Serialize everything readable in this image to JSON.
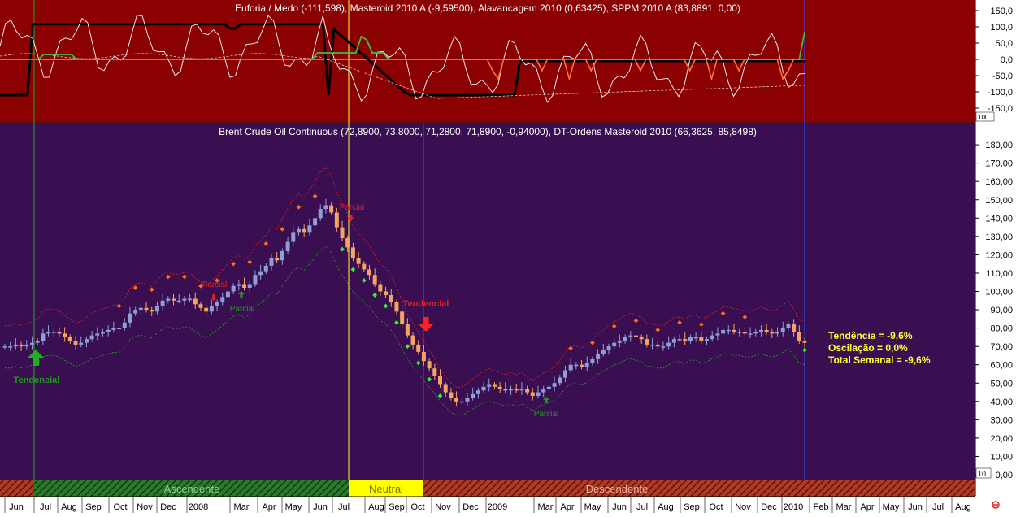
{
  "top_panel": {
    "title": "Euforia / Medo (-111,598), Masteroid 2010 A (-9,59500), Alavancagem 2010 (0,63425), SPPM 2010 A (83,8891, 0,00)",
    "y_ticks": [
      "150,0",
      "100,0",
      "50,0",
      "0,0",
      "-50,0",
      "-100,0",
      "-150,0"
    ],
    "scale_badge": "100",
    "background": "#8b0000"
  },
  "main_panel": {
    "title": "Brent Crude Oil Continuous (72,8900, 73,8000, 71,2800, 71,8900, -0,94000), DT-Ordens Masteroid 2010 (66,3625, 85,8498)",
    "y_ticks": [
      "180,00",
      "170,00",
      "160,00",
      "150,00",
      "140,00",
      "130,00",
      "120,00",
      "110,00",
      "100,00",
      "90,00",
      "80,00",
      "70,00",
      "60,00",
      "50,00",
      "40,00",
      "30,00",
      "20,00",
      "10,00",
      "0,00"
    ],
    "scale_badge": "10",
    "background": "#3a0f52",
    "annotations": [
      {
        "text": "Tendencial",
        "color": "#1f9a1f"
      },
      {
        "text": "Parcial",
        "color": "#e02020"
      },
      {
        "text": "Parcial",
        "color": "#1f9a1f"
      },
      {
        "text": "Parcial",
        "color": "#e02020"
      },
      {
        "text": "Tendencial",
        "color": "#e02020"
      },
      {
        "text": "Parcial",
        "color": "#1f9a1f"
      }
    ]
  },
  "status": {
    "tendencia": "Tendência = -9,6%",
    "oscilacao": "Oscilação = 0,0%",
    "total": "Total Semanal = -9,6%"
  },
  "regime_bar": {
    "ascendente": "Ascendente",
    "neutral": "Neutral",
    "descendente": "Descendente"
  },
  "x_axis": {
    "labels": [
      "Jun",
      "Jul",
      "Aug",
      "Sep",
      "Oct",
      "Nov",
      "Dec",
      "2008",
      "Mar",
      "Apr",
      "May",
      "Jun",
      "Jul",
      "Aug",
      "Sep",
      "Oct",
      "Nov",
      "Dec",
      "2009",
      "Mar",
      "Apr",
      "May",
      "Jun",
      "Jul",
      "Aug",
      "Sep",
      "Oct",
      "Nov",
      "Dec",
      "2010",
      "Feb",
      "Mar",
      "Apr",
      "May",
      "Jun",
      "Jul",
      "Aug"
    ]
  },
  "chart_data": {
    "type": "candlestick",
    "title": "Brent Crude Oil Continuous (72,8900, 73,8000, 71,2800, 71,8900, -0,94000)",
    "ylim": [
      0,
      190
    ],
    "close": [
      70,
      70,
      71,
      70,
      71,
      72,
      73,
      77,
      78,
      78,
      77,
      75,
      73,
      71,
      72,
      74,
      76,
      77,
      78,
      79,
      80,
      80,
      83,
      88,
      90,
      91,
      90,
      89,
      92,
      95,
      96,
      95,
      95,
      96,
      96,
      93,
      91,
      89,
      92,
      94,
      97,
      100,
      103,
      104,
      102,
      104,
      109,
      111,
      114,
      118,
      117,
      122,
      127,
      132,
      134,
      132,
      136,
      140,
      145,
      147,
      143,
      135,
      129,
      124,
      118,
      115,
      112,
      109,
      104,
      100,
      98,
      94,
      89,
      82,
      76,
      71,
      67,
      62,
      58,
      54,
      49,
      45,
      42,
      40,
      40,
      42,
      44,
      46,
      48,
      49,
      48,
      47,
      46,
      47,
      46,
      47,
      45,
      43,
      45,
      47,
      48,
      50,
      53,
      57,
      60,
      60,
      59,
      61,
      63,
      66,
      68,
      70,
      72,
      73,
      75,
      76,
      75,
      74,
      71,
      71,
      70,
      70,
      72,
      74,
      74,
      73,
      75,
      75,
      73,
      74,
      76,
      77,
      79,
      79,
      78,
      78,
      77,
      77,
      78,
      79,
      78,
      77,
      78,
      80,
      82,
      78,
      73,
      72
    ]
  }
}
